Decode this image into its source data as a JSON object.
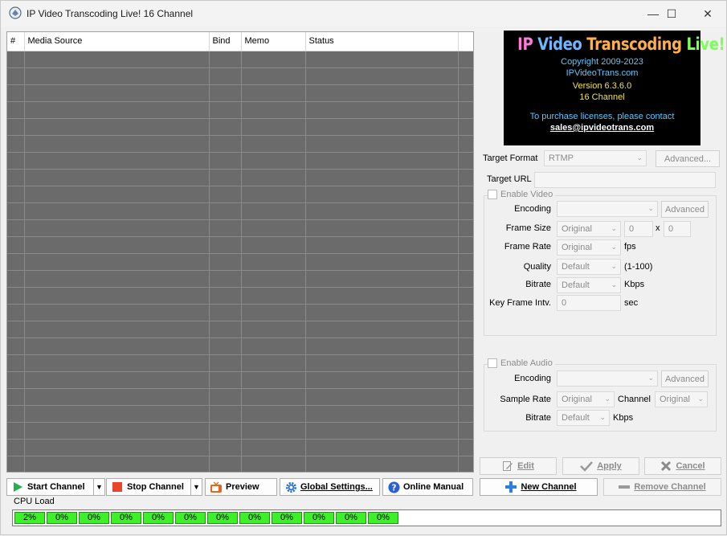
{
  "window": {
    "title": "IP Video Transcoding Live! 16 Channel",
    "minimize": "—",
    "maximize": "☐",
    "close": "✕"
  },
  "grid": {
    "columns": [
      "#",
      "Media Source",
      "Bind",
      "Memo",
      "Status"
    ]
  },
  "logo": {
    "title_parts": [
      "IP ",
      "Video ",
      "Transcoding ",
      "Live!"
    ],
    "copyright": "Copyright 2009-2023",
    "site": "IPVideoTrans.com",
    "version": "Version 6.3.6.0",
    "channels": "16 Channel",
    "purchase": "To purchase licenses, please contact",
    "email": "sales@ipvideotrans.com"
  },
  "target": {
    "format_label": "Target Format",
    "format_value": "RTMP",
    "advanced_label": "Advanced...",
    "url_label": "Target URL",
    "url_value": ""
  },
  "video": {
    "enable_label": "Enable Video",
    "encoding_label": "Encoding",
    "encoding_value": "",
    "advanced_label": "Advanced",
    "frame_size_label": "Frame Size",
    "frame_size_value": "Original",
    "width_value": "0",
    "x_label": "x",
    "height_value": "0",
    "frame_rate_label": "Frame Rate",
    "frame_rate_value": "Original",
    "fps_label": "fps",
    "quality_label": "Quality",
    "quality_value": "Default",
    "quality_range": "(1-100)",
    "bitrate_label": "Bitrate",
    "bitrate_value": "Default",
    "kbps_label": "Kbps",
    "keyframe_label": "Key Frame Intv.",
    "keyframe_value": "0",
    "sec_label": "sec"
  },
  "audio": {
    "enable_label": "Enable Audio",
    "encoding_label": "Encoding",
    "encoding_value": "",
    "advanced_label": "Advanced",
    "sample_rate_label": "Sample Rate",
    "sample_rate_value": "Original",
    "channel_label": "Channel",
    "channel_value": "Original",
    "bitrate_label": "Bitrate",
    "bitrate_value": "Default",
    "kbps_label": "Kbps"
  },
  "actions": {
    "edit": "Edit",
    "apply": "Apply",
    "cancel": "Cancel",
    "new_channel": "New Channel",
    "remove_channel": "Remove Channel"
  },
  "toolbar": {
    "start_channel": "Start Channel",
    "stop_channel": "Stop Channel",
    "preview": "Preview",
    "global_settings": "Global Settings...",
    "online_manual": "Online Manual"
  },
  "cpu": {
    "label": "CPU Load",
    "values": [
      "2%",
      "0%",
      "0%",
      "0%",
      "0%",
      "0%",
      "0%",
      "0%",
      "0%",
      "0%",
      "0%",
      "0%"
    ]
  },
  "colors": {
    "logo_cyan": "#5ec8ff",
    "logo_yellow": "#f2e34a",
    "cpu_green": "#3ef02a",
    "grid_gray": "#6b6b6b"
  }
}
